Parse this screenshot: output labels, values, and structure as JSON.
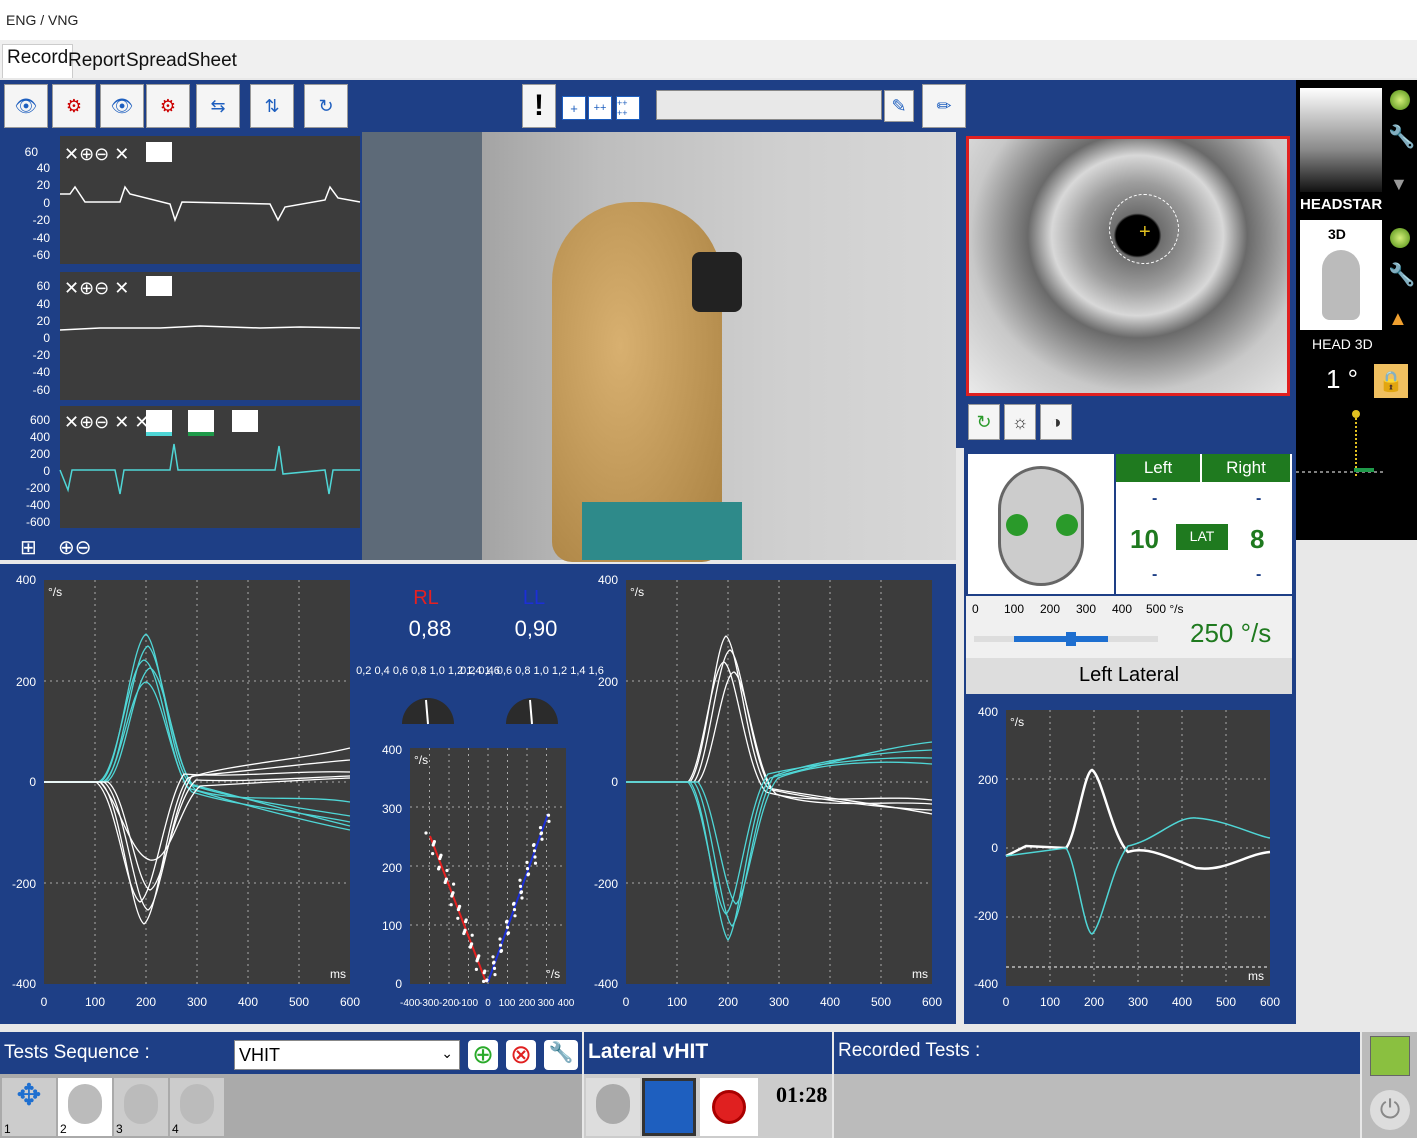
{
  "window": {
    "title": "ENG / VNG"
  },
  "tabs": [
    {
      "label": "Record"
    },
    {
      "label": "Report"
    },
    {
      "label": "SpreadSheet"
    }
  ],
  "toolbar": {
    "alert": "!",
    "add_single": "+",
    "add_double": "++",
    "add_quad": "++\n++",
    "note_value": ""
  },
  "traces": {
    "t1": {
      "ticks": [
        "60",
        "40",
        "20",
        "0",
        "-20",
        "-40",
        "-60"
      ]
    },
    "t2": {
      "ticks": [
        "60",
        "40",
        "20",
        "0",
        "-20",
        "-40",
        "-60"
      ]
    },
    "t3": {
      "ticks": [
        "600",
        "400",
        "200",
        "0",
        "-200",
        "-400",
        "-600"
      ]
    }
  },
  "gains": {
    "rl_label": "RL",
    "rl_value": "0,88",
    "ll_label": "LL",
    "ll_value": "0,90",
    "dial_ticks": "0,2 0,4 0,6 0,8 1,0 1,2 1,4 1,6",
    "rl_color": "#e52020",
    "ll_color": "#1c2fd6"
  },
  "plots": {
    "unit": "°/s",
    "xunit": "ms",
    "yticks": [
      "400",
      "200",
      "0",
      "-200",
      "-400"
    ],
    "xticks": [
      "0",
      "100",
      "200",
      "300",
      "400",
      "500",
      "600"
    ],
    "regression": {
      "yticks": [
        "400",
        "300",
        "200",
        "100",
        "0"
      ],
      "xticks": [
        "-400",
        "-300",
        "-200",
        "-100",
        "0",
        "100",
        "200",
        "300",
        "400"
      ]
    }
  },
  "headstar": {
    "label": "HEADSTAR",
    "threed": "3D",
    "head3d_label": "HEAD 3D",
    "angle": "1 °"
  },
  "lateral": {
    "left_label": "Left",
    "right_label": "Right",
    "left_count": "10",
    "right_count": "8",
    "mode": "LAT",
    "dash": "-",
    "speed_ticks": [
      "0",
      "100",
      "200",
      "300",
      "400",
      "500 °/s"
    ],
    "speed_value": "250 °/s",
    "plot_title": "Left Lateral"
  },
  "bottom": {
    "tests_sequence_label": "Tests Sequence :",
    "sequence_value": "VHIT",
    "test_name": "Lateral vHIT",
    "timer": "01:28",
    "recorded_tests_label": "Recorded Tests :",
    "sequence_items": [
      "1",
      "2",
      "3",
      "4"
    ]
  },
  "colors": {
    "panel_blue": "#1e3f86",
    "plot_bg": "#3c3c3c",
    "cyan": "#4fd6d6",
    "green": "#1f7a1f"
  }
}
